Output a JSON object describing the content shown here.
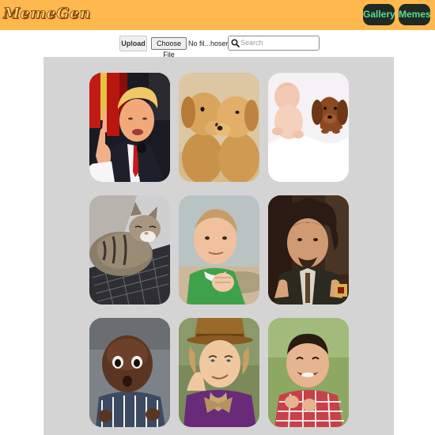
{
  "header": {
    "logo": "MemeGen",
    "nav": [
      {
        "label": "Gallery"
      },
      {
        "label": "Memes"
      }
    ]
  },
  "toolbar": {
    "upload_label": "Upload",
    "choose_file_label": "Choose File",
    "file_status": "No fil...hosen",
    "search_placeholder": "Search"
  },
  "gallery": {
    "images": [
      {
        "subject": "man in suit pointing upward"
      },
      {
        "subject": "two golden retriever puppies"
      },
      {
        "subject": "sleeping baby and dachshund puppy"
      },
      {
        "subject": "tabby cat sleeping on laptop keyboard"
      },
      {
        "subject": "success kid clenching fist"
      },
      {
        "subject": "man with wild hair gesturing"
      },
      {
        "subject": "surprised baby with wide eyes"
      },
      {
        "subject": "man in top hat resting chin on hand"
      },
      {
        "subject": "laughing toddler in checkered shirt"
      }
    ]
  },
  "colors": {
    "header_bg": "#ffb84d",
    "nav_bg": "#1f2a24",
    "nav_text": "#5cdc8f",
    "gallery_bg": "#d4d4d4"
  }
}
